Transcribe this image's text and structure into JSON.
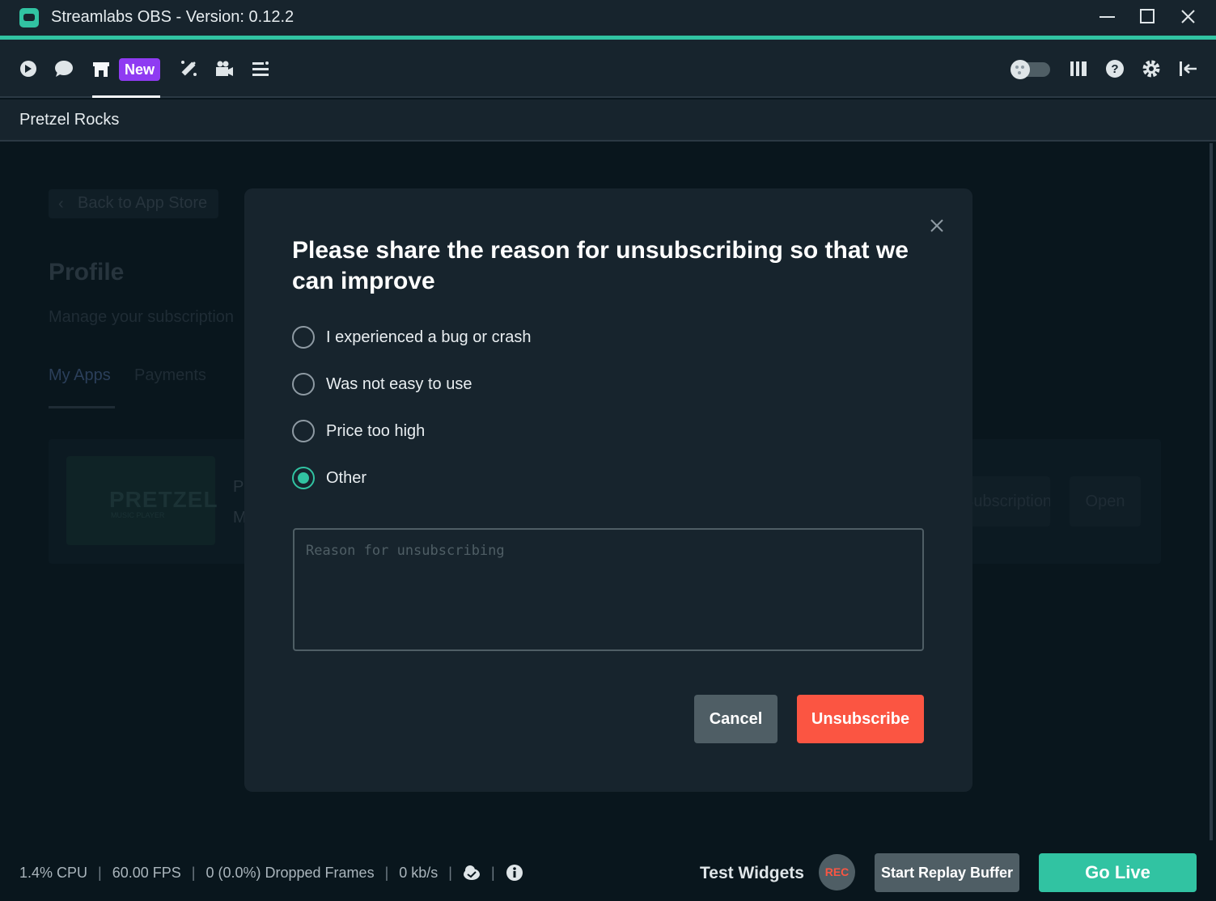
{
  "window": {
    "title": "Streamlabs OBS - Version: 0.12.2",
    "controls": [
      "minimize-icon",
      "maximize-icon",
      "close-icon"
    ]
  },
  "toolbar": {
    "new_badge": "New",
    "left_icons": [
      "dashboard-icon",
      "chat-icon",
      "app-store-icon",
      "themes-icon",
      "studio-icon",
      "layout-editor-icon"
    ],
    "right_icons": [
      "theme-toggle",
      "columns-icon",
      "help-icon",
      "settings-icon",
      "collapse-icon"
    ]
  },
  "subheader": {
    "title": "Pretzel Rocks"
  },
  "background": {
    "back_link": "Back to App Store",
    "profile_title": "Profile",
    "manage_text": "Manage your subscription",
    "tabs": [
      "My Apps",
      "Payments"
    ],
    "card": {
      "logo_text": "PRETZEL",
      "logo_sub": "MUSIC PLAYER",
      "line1": "P",
      "line2": "M",
      "subscription_button": "Subscription",
      "open_button": "Open"
    }
  },
  "modal": {
    "heading": "Please share the reason for unsubscribing so that we can improve",
    "options": [
      {
        "label": "I experienced a bug or crash",
        "checked": false
      },
      {
        "label": "Was not easy to use",
        "checked": false
      },
      {
        "label": "Price too high",
        "checked": false
      },
      {
        "label": "Other",
        "checked": true
      }
    ],
    "reason_placeholder": "Reason for unsubscribing",
    "reason_value": "",
    "cancel_label": "Cancel",
    "unsubscribe_label": "Unsubscribe"
  },
  "footer": {
    "cpu": "1.4% CPU",
    "fps": "60.00 FPS",
    "dropped": "0 (0.0%) Dropped Frames",
    "bitrate": "0 kb/s",
    "test_widgets": "Test Widgets",
    "rec": "REC",
    "replay": "Start Replay Buffer",
    "go_live": "Go Live"
  },
  "colors": {
    "accent": "#31c3a2",
    "danger": "#fb5542",
    "new_badge": "#8f3bf2",
    "panel": "#17242d",
    "background": "#09161d"
  }
}
